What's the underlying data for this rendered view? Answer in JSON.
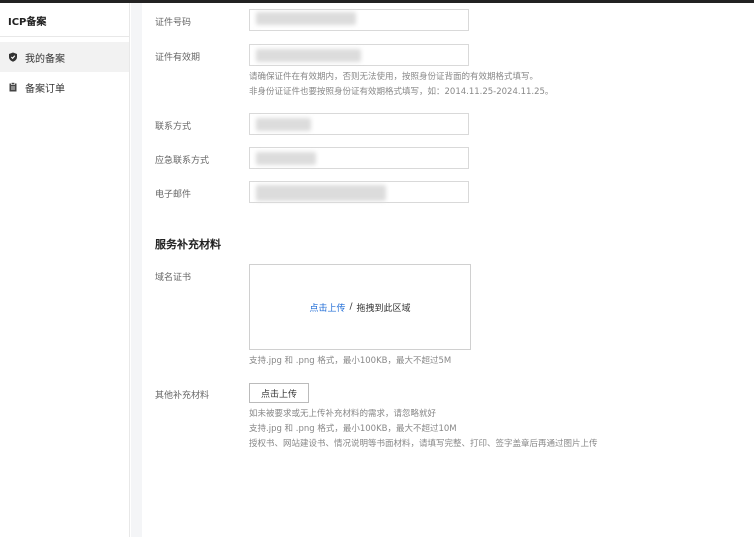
{
  "sidebar": {
    "title": "ICP备案",
    "items": [
      {
        "label": "我的备案",
        "icon": "shield-icon",
        "active": true
      },
      {
        "label": "备案订单",
        "icon": "clipboard-icon",
        "active": false
      }
    ]
  },
  "form": {
    "id_number_label": "证件号码",
    "id_validity_label": "证件有效期",
    "validity_hint_1": "请确保证件在有效期内，否则无法使用，按照身份证背面的有效期格式填写。",
    "validity_hint_2": "非身份证证件也要按照身份证有效期格式填写，如：2014.11.25-2024.11.25。",
    "contact_label": "联系方式",
    "emergency_contact_label": "应急联系方式",
    "email_label": "电子邮件"
  },
  "service": {
    "section_title": "服务补充材料",
    "domain_cert_label": "域名证书",
    "dropzone_link": "点击上传",
    "dropzone_sep": "/",
    "dropzone_text": "拖拽到此区域",
    "domain_cert_hint": "支持.jpg 和 .png 格式，最小100KB，最大不超过5M",
    "other_label": "其他补充材料",
    "upload_button": "点击上传",
    "other_hint_1": "如未被要求或无上传补充材料的需求，请忽略就好",
    "other_hint_2": "支持.jpg 和 .png 格式，最小100KB，最大不超过10M",
    "other_hint_3": "授权书、网站建设书、情况说明等书面材料，请填写完整、打印、签字盖章后再通过图片上传"
  }
}
